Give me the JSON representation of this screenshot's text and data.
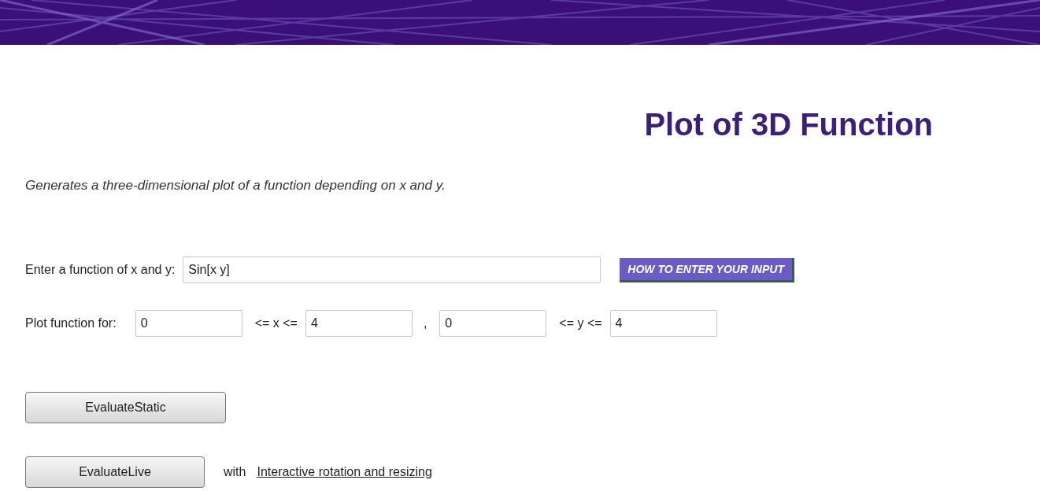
{
  "title": "Plot of 3D Function",
  "description": "Generates a three-dimensional plot of a function depending on x and y.",
  "function_row": {
    "label": "Enter a function of x and y:",
    "value": "Sin[x y]",
    "help_button": "HOW TO ENTER YOUR INPUT"
  },
  "range_row": {
    "label": "Plot function for:",
    "x_min": "0",
    "x_sep": "<= x <=",
    "x_max": "4",
    "comma": ",",
    "y_min": "0",
    "y_sep": "<= y <=",
    "y_max": "4"
  },
  "static_button": "EvaluateStatic",
  "live_row": {
    "button": "EvaluateLive",
    "with": "with",
    "link": "Interactive rotation and resizing"
  }
}
